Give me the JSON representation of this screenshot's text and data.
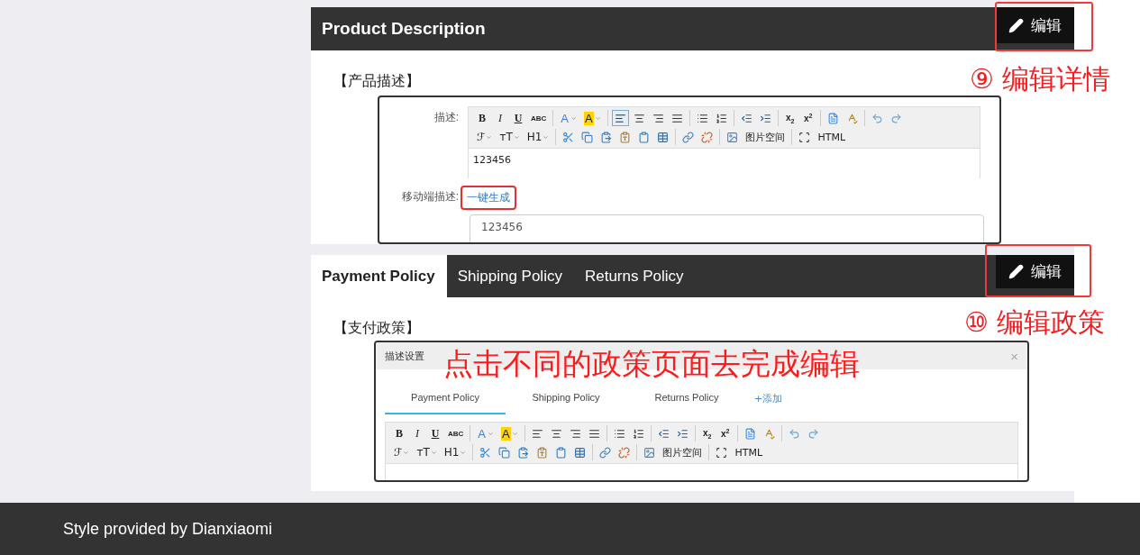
{
  "product_description": {
    "title": "Product Description",
    "edit_button": {
      "label": "编辑",
      "highlighted": true
    },
    "section_label": "【产品描述】",
    "form": {
      "description_label": "描述:",
      "toolbar": [
        [
          [
            {
              "kind": "bold",
              "label": "B"
            },
            {
              "kind": "italic",
              "label": "I"
            },
            {
              "kind": "underline",
              "label": "U"
            },
            {
              "kind": "small",
              "label": "ABC"
            }
          ],
          [
            {
              "kind": "fontcolor",
              "label": "A"
            },
            {
              "kind": "highlight",
              "label": "A"
            }
          ],
          [
            {
              "kind": "icon",
              "selected": true
            },
            {
              "kind": "icon",
              "selected": false
            },
            {
              "kind": "icon",
              "selected": false
            },
            {
              "kind": "icon",
              "selected": false
            }
          ],
          [
            {
              "kind": "icon"
            },
            {
              "kind": "icon"
            }
          ],
          [
            {
              "kind": "icon"
            },
            {
              "kind": "icon"
            }
          ],
          [
            {
              "kind": "script",
              "label": "x$_{2}$"
            },
            {
              "kind": "script",
              "label": "x$^{2}$"
            }
          ],
          [
            {
              "kind": "icon"
            },
            {
              "kind": "icon"
            }
          ],
          [
            {
              "kind": "icon"
            },
            {
              "kind": "icon"
            }
          ]
        ],
        [
          [
            {
              "kind": "menu",
              "label": "ℱ"
            },
            {
              "kind": "menu",
              "label": "ᴛT"
            },
            {
              "kind": "menu",
              "label": "H1"
            }
          ],
          [
            {
              "kind": "icon"
            },
            {
              "kind": "icon"
            },
            {
              "kind": "icon"
            },
            {
              "kind": "icon"
            },
            {
              "kind": "icon"
            },
            {
              "kind": "icon"
            }
          ],
          [
            {
              "kind": "icon"
            },
            {
              "kind": "icon"
            }
          ],
          [
            {
              "kind": "icon"
            },
            {
              "kind": "text",
              "label": "图片空间"
            }
          ],
          [
            {
              "kind": "icon"
            },
            {
              "kind": "text",
              "label": "HTML"
            }
          ]
        ]
      ],
      "content": "123456",
      "mobile_label": "移动端描述:",
      "generate_link": {
        "label": "一键生成",
        "highlighted": true
      },
      "mobile_value": "123456"
    },
    "callout": "⑨ 编辑详情"
  },
  "policies": {
    "tabs": [
      {
        "label": "Payment Policy",
        "selected": true
      },
      {
        "label": "Shipping Policy",
        "selected": false
      },
      {
        "label": "Returns Policy",
        "selected": false
      }
    ],
    "edit_button": {
      "label": "编辑",
      "highlighted": true
    },
    "section_label": "【支付政策】",
    "dialog": {
      "title": "描述设置",
      "close": "×",
      "note": "点击不同的政策页面去完成编辑",
      "tabs": [
        {
          "label": "Payment Policy",
          "selected": true
        },
        {
          "label": "Shipping Policy",
          "selected": false
        },
        {
          "label": "Returns Policy",
          "selected": false
        }
      ],
      "add_link": "+添加",
      "toolbar": [
        [
          [
            {
              "kind": "bold",
              "label": "B"
            },
            {
              "kind": "italic",
              "label": "I"
            },
            {
              "kind": "underline",
              "label": "U"
            },
            {
              "kind": "small",
              "label": "ABC"
            }
          ],
          [
            {
              "kind": "fontcolor",
              "label": "A"
            },
            {
              "kind": "highlight",
              "label": "A"
            }
          ],
          [
            {
              "kind": "icon",
              "selected": false
            },
            {
              "kind": "icon",
              "selected": false
            },
            {
              "kind": "icon",
              "selected": false
            },
            {
              "kind": "icon",
              "selected": false
            }
          ],
          [
            {
              "kind": "icon"
            },
            {
              "kind": "icon"
            }
          ],
          [
            {
              "kind": "icon"
            },
            {
              "kind": "icon"
            }
          ],
          [
            {
              "kind": "script",
              "label": "x$_{2}$"
            },
            {
              "kind": "script",
              "label": "x$^{2}$"
            }
          ],
          [
            {
              "kind": "icon"
            },
            {
              "kind": "icon"
            }
          ],
          [
            {
              "kind": "icon"
            },
            {
              "kind": "icon"
            }
          ]
        ],
        [
          [
            {
              "kind": "menu",
              "label": "ℱ"
            },
            {
              "kind": "menu",
              "label": "ᴛT"
            },
            {
              "kind": "menu",
              "label": "H1"
            }
          ],
          [
            {
              "kind": "icon"
            },
            {
              "kind": "icon"
            },
            {
              "kind": "icon"
            },
            {
              "kind": "icon"
            },
            {
              "kind": "icon"
            },
            {
              "kind": "icon"
            }
          ],
          [
            {
              "kind": "icon"
            },
            {
              "kind": "icon"
            }
          ],
          [
            {
              "kind": "icon"
            },
            {
              "kind": "text",
              "label": "图片空间"
            }
          ],
          [
            {
              "kind": "icon"
            },
            {
              "kind": "text",
              "label": "HTML"
            }
          ]
        ]
      ]
    },
    "callout": "⑩ 编辑政策"
  },
  "footer": {
    "text": "Style provided by Dianxiaomi"
  }
}
